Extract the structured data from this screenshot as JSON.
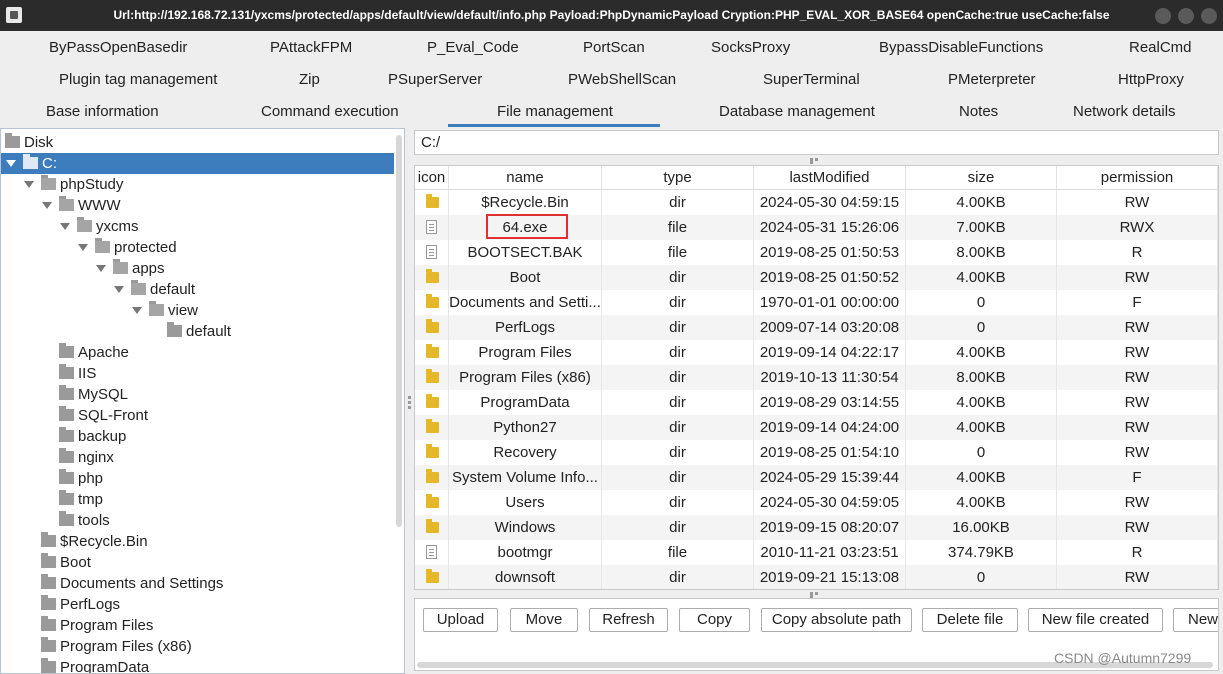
{
  "title_bar": {
    "title": "Url:http://192.168.72.131/yxcms/protected/apps/default/view/default/info.php Payload:PhpDynamicPayload Cryption:PHP_EVAL_XOR_BASE64 openCache:true useCache:false"
  },
  "plugins": {
    "row1": [
      "ByPassOpenBasedir",
      "PAttackFPM",
      "P_Eval_Code",
      "PortScan",
      "SocksProxy",
      "BypassDisableFunctions",
      "RealCmd"
    ],
    "row2": [
      "Plugin tag management",
      "Zip",
      "PSuperServer",
      "PWebShellScan",
      "SuperTerminal",
      "PMeterpreter",
      "HttpProxy"
    ],
    "row3": [
      "Base information",
      "Command execution",
      "File management",
      "Database management",
      "Notes",
      "Network details"
    ],
    "active_tab": "File management"
  },
  "tree": [
    {
      "label": "Disk",
      "expanded": false,
      "selected": false
    },
    {
      "label": "C:",
      "expanded": true,
      "selected": true
    },
    {
      "label": "phpStudy",
      "expanded": true,
      "selected": false
    },
    {
      "label": "WWW",
      "expanded": true,
      "selected": false
    },
    {
      "label": "yxcms",
      "expanded": true,
      "selected": false
    },
    {
      "label": "protected",
      "expanded": true,
      "selected": false
    },
    {
      "label": "apps",
      "expanded": true,
      "selected": false
    },
    {
      "label": "default",
      "expanded": true,
      "selected": false
    },
    {
      "label": "view",
      "expanded": true,
      "selected": false
    },
    {
      "label": "default",
      "expanded": false,
      "selected": false
    },
    {
      "label": "Apache",
      "expanded": false,
      "selected": false
    },
    {
      "label": "IIS",
      "expanded": false,
      "selected": false
    },
    {
      "label": "MySQL",
      "expanded": false,
      "selected": false
    },
    {
      "label": "SQL-Front",
      "expanded": false,
      "selected": false
    },
    {
      "label": "backup",
      "expanded": false,
      "selected": false
    },
    {
      "label": "nginx",
      "expanded": false,
      "selected": false
    },
    {
      "label": "php",
      "expanded": false,
      "selected": false
    },
    {
      "label": "tmp",
      "expanded": false,
      "selected": false
    },
    {
      "label": "tools",
      "expanded": false,
      "selected": false
    },
    {
      "label": "$Recycle.Bin",
      "expanded": false,
      "selected": false
    },
    {
      "label": "Boot",
      "expanded": false,
      "selected": false
    },
    {
      "label": "Documents and Settings",
      "expanded": false,
      "selected": false
    },
    {
      "label": "PerfLogs",
      "expanded": false,
      "selected": false
    },
    {
      "label": "Program Files",
      "expanded": false,
      "selected": false
    },
    {
      "label": "Program Files (x86)",
      "expanded": false,
      "selected": false
    },
    {
      "label": "ProgramData",
      "expanded": false,
      "selected": false
    }
  ],
  "path": "C:/",
  "table": {
    "headers": [
      "icon",
      "name",
      "type",
      "lastModified",
      "size",
      "permission"
    ],
    "rows": [
      {
        "icon": "folder-icon",
        "name": "$Recycle.Bin",
        "type": "dir",
        "lastModified": "2024-05-30 04:59:15",
        "size": "4.00KB",
        "permission": "RW"
      },
      {
        "icon": "file-icon",
        "name": "64.exe",
        "type": "file",
        "lastModified": "2024-05-31 15:26:06",
        "size": "7.00KB",
        "permission": "RWX"
      },
      {
        "icon": "file-icon",
        "name": "BOOTSECT.BAK",
        "type": "file",
        "lastModified": "2019-08-25 01:50:53",
        "size": "8.00KB",
        "permission": "R"
      },
      {
        "icon": "folder-icon",
        "name": "Boot",
        "type": "dir",
        "lastModified": "2019-08-25 01:50:52",
        "size": "4.00KB",
        "permission": "RW"
      },
      {
        "icon": "folder-icon",
        "name": "Documents and Setti...",
        "type": "dir",
        "lastModified": "1970-01-01 00:00:00",
        "size": "0",
        "permission": "F"
      },
      {
        "icon": "folder-icon",
        "name": "PerfLogs",
        "type": "dir",
        "lastModified": "2009-07-14 03:20:08",
        "size": "0",
        "permission": "RW"
      },
      {
        "icon": "folder-icon",
        "name": "Program Files",
        "type": "dir",
        "lastModified": "2019-09-14 04:22:17",
        "size": "4.00KB",
        "permission": "RW"
      },
      {
        "icon": "folder-icon",
        "name": "Program Files (x86)",
        "type": "dir",
        "lastModified": "2019-10-13 11:30:54",
        "size": "8.00KB",
        "permission": "RW"
      },
      {
        "icon": "folder-icon",
        "name": "ProgramData",
        "type": "dir",
        "lastModified": "2019-08-29 03:14:55",
        "size": "4.00KB",
        "permission": "RW"
      },
      {
        "icon": "folder-icon",
        "name": "Python27",
        "type": "dir",
        "lastModified": "2019-09-14 04:24:00",
        "size": "4.00KB",
        "permission": "RW"
      },
      {
        "icon": "folder-icon",
        "name": "Recovery",
        "type": "dir",
        "lastModified": "2019-08-25 01:54:10",
        "size": "0",
        "permission": "RW"
      },
      {
        "icon": "folder-icon",
        "name": "System Volume Info...",
        "type": "dir",
        "lastModified": "2024-05-29 15:39:44",
        "size": "4.00KB",
        "permission": "F"
      },
      {
        "icon": "folder-icon",
        "name": "Users",
        "type": "dir",
        "lastModified": "2024-05-30 04:59:05",
        "size": "4.00KB",
        "permission": "RW"
      },
      {
        "icon": "folder-icon",
        "name": "Windows",
        "type": "dir",
        "lastModified": "2019-09-15 08:20:07",
        "size": "16.00KB",
        "permission": "RW"
      },
      {
        "icon": "file-icon",
        "name": "bootmgr",
        "type": "file",
        "lastModified": "2010-11-21 03:23:51",
        "size": "374.79KB",
        "permission": "R"
      },
      {
        "icon": "folder-icon",
        "name": "downsoft",
        "type": "dir",
        "lastModified": "2019-09-21 15:13:08",
        "size": "0",
        "permission": "RW"
      }
    ]
  },
  "buttons": [
    "Upload",
    "Move",
    "Refresh",
    "Copy",
    "Copy absolute path",
    "Delete file",
    "New file created",
    "New"
  ],
  "watermark": "CSDN @Autumn7299",
  "colors": {
    "title_bar": "#2b2b2b",
    "selection": "#3d7dbd",
    "highlight_box": "#e03030",
    "folder_icon": "#e5b82a"
  }
}
